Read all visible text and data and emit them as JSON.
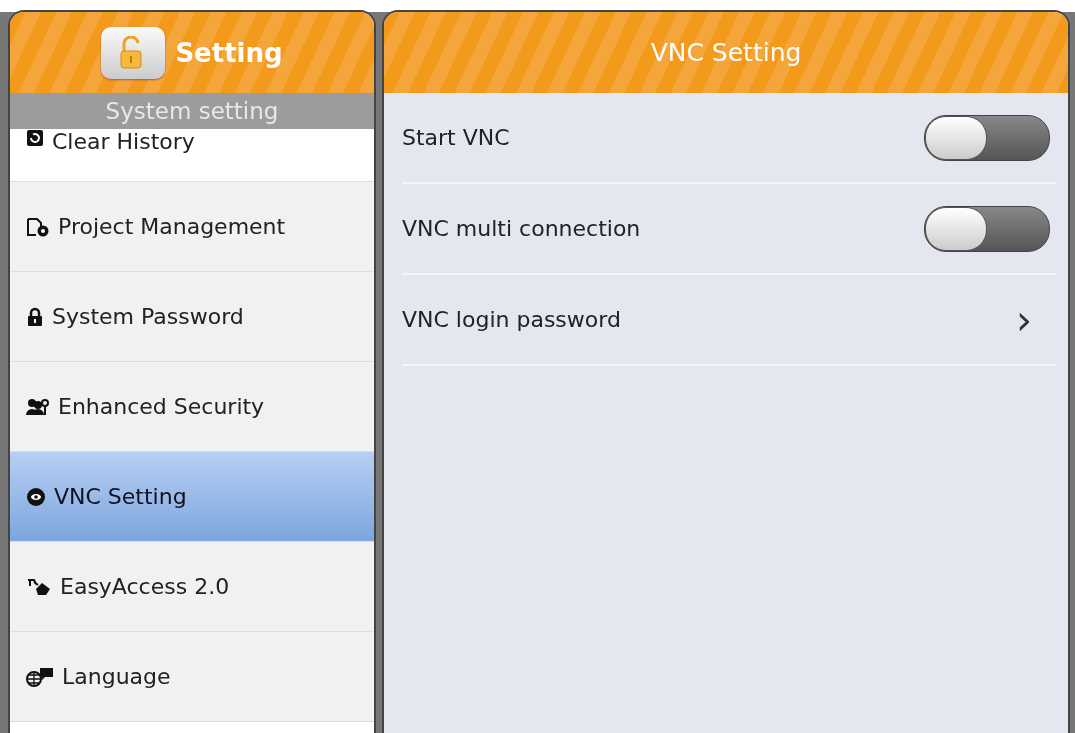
{
  "sidebar": {
    "title": "Setting",
    "section": "System setting",
    "items": [
      {
        "label": "Clear History",
        "selected": false
      },
      {
        "label": "Project Management",
        "selected": false
      },
      {
        "label": "System Password",
        "selected": false
      },
      {
        "label": "Enhanced Security",
        "selected": false
      },
      {
        "label": "VNC Setting",
        "selected": true
      },
      {
        "label": "EasyAccess 2.0",
        "selected": false
      },
      {
        "label": "Language",
        "selected": false
      }
    ]
  },
  "panel": {
    "title": "VNC Setting",
    "rows": [
      {
        "kind": "toggle",
        "label": "Start VNC",
        "on": false
      },
      {
        "kind": "toggle",
        "label": "VNC multi connection",
        "on": false
      },
      {
        "kind": "link",
        "label": "VNC login password",
        "chevron": "›"
      }
    ]
  }
}
